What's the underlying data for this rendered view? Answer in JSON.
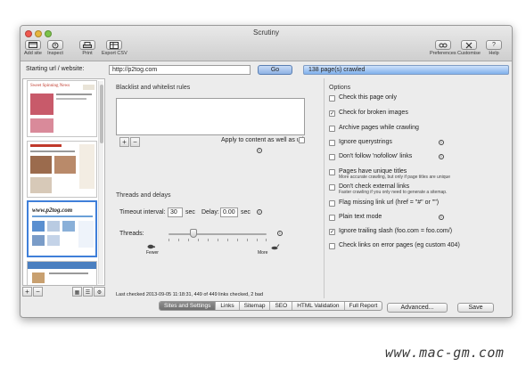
{
  "window": {
    "title": "Scrutiny"
  },
  "toolbar": {
    "left": [
      {
        "label": "Add site",
        "icon": "add-site-icon"
      },
      {
        "label": "Inspect",
        "icon": "inspect-icon"
      },
      {
        "label": "Print",
        "icon": "print-icon"
      },
      {
        "label": "Export CSV",
        "icon": "export-csv-icon"
      }
    ],
    "right": [
      {
        "label": "Preferences",
        "icon": "preferences-icon"
      },
      {
        "label": "Customise",
        "icon": "customise-icon"
      },
      {
        "label": "Help",
        "icon": "help-icon"
      }
    ]
  },
  "urlbar": {
    "label": "Starting url / website:",
    "value": "http://p2tog.com",
    "go": "Go",
    "status": "138 page(s) crawled",
    "progress": 1.0
  },
  "thumbnails": [
    {
      "heading": "Sweet Spinning News",
      "selected": false
    },
    {
      "heading": "",
      "selected": false
    },
    {
      "heading": "www.p2tog.com",
      "selected": true
    },
    {
      "heading": "",
      "selected": false
    }
  ],
  "sidebar_controls": {
    "add": "+",
    "remove": "−"
  },
  "blacklist": {
    "title": "Blacklist and whitelist rules",
    "add": "+",
    "remove": "−",
    "apply_label": "Apply to content as well as url",
    "apply_checked": false
  },
  "threads": {
    "title": "Threads and delays",
    "timeout_label": "Timeout interval:",
    "timeout_value": "30",
    "timeout_unit": "sec",
    "delay_label": "Delay:",
    "delay_value": "0.00",
    "delay_unit": "sec",
    "threads_label": "Threads:",
    "threads_level": 0.2,
    "fewer": "Fewer",
    "more": "More"
  },
  "last_checked": "Last checked 2013-09-05 11:18:31, 449 of 449 links checked, 2 bad",
  "options": {
    "title": "Options",
    "items": [
      {
        "label": "Check this page only",
        "checked": false,
        "info": false
      },
      {
        "label": "Check for broken images",
        "checked": true,
        "info": false
      },
      {
        "label": "Archive pages while crawling",
        "checked": false,
        "info": false
      },
      {
        "label": "Ignore querystrings",
        "checked": false,
        "info": true
      },
      {
        "label": "Don't follow 'nofollow' links",
        "checked": false,
        "info": true
      },
      {
        "label": "Pages have unique titles",
        "sub": "More accurate crawling, but only if page titles are unique",
        "checked": false,
        "info": false
      },
      {
        "label": "Don't check external links",
        "sub": "Faster crawling if you only need to generate a sitemap.",
        "checked": false,
        "info": false
      },
      {
        "label": "Flag missing link url (href = \"#\"  or  \"\")",
        "checked": false,
        "info": false
      },
      {
        "label": "Plain text mode",
        "checked": false,
        "info": true
      },
      {
        "label": "Ignore trailing slash (foo.com = foo.com/)",
        "checked": true,
        "info": false
      },
      {
        "label": "Check links on error pages (eg custom 404)",
        "checked": false,
        "info": false
      }
    ]
  },
  "buttons": {
    "advanced": "Advanced...",
    "save": "Save"
  },
  "tabs": [
    {
      "label": "Sites and Settings",
      "active": true
    },
    {
      "label": "Links",
      "active": false
    },
    {
      "label": "Sitemap",
      "active": false
    },
    {
      "label": "SEO",
      "active": false
    },
    {
      "label": "HTML Validation",
      "active": false
    },
    {
      "label": "Full Report",
      "active": false
    }
  ],
  "watermark": "www.mac-gm.com"
}
